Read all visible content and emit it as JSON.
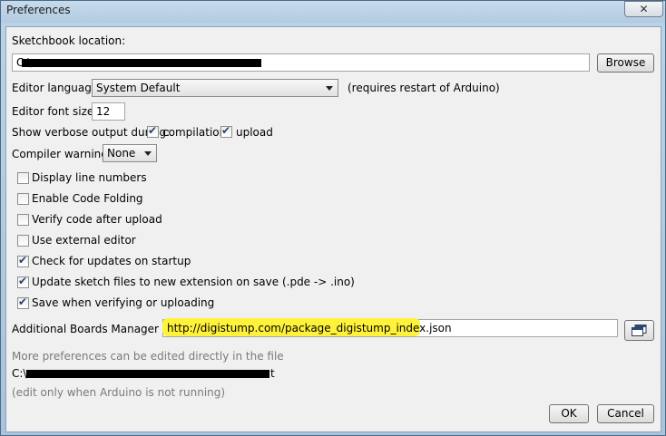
{
  "window": {
    "title": "Preferences",
    "close_glyph": "✕"
  },
  "sketchbook": {
    "label": "Sketchbook location:",
    "value": "C:\\",
    "browse_label": "Browse"
  },
  "language": {
    "label": "Editor language:",
    "value": "System Default",
    "note": "(requires restart of Arduino)"
  },
  "font_size": {
    "label": "Editor font size:",
    "value": "12"
  },
  "verbose": {
    "label": "Show verbose output during:",
    "compilation_label": "compilation",
    "compilation_checked": true,
    "upload_label": "upload",
    "upload_checked": true
  },
  "warnings": {
    "label": "Compiler warnings:",
    "value": "None"
  },
  "options": [
    {
      "label": "Display line numbers",
      "checked": false
    },
    {
      "label": "Enable Code Folding",
      "checked": false
    },
    {
      "label": "Verify code after upload",
      "checked": false
    },
    {
      "label": "Use external editor",
      "checked": false
    },
    {
      "label": "Check for updates on startup",
      "checked": true
    },
    {
      "label": "Update sketch files to new extension on save (.pde -> .ino)",
      "checked": true
    },
    {
      "label": "Save when verifying or uploading",
      "checked": true
    }
  ],
  "boards": {
    "label": "Additional Boards Manager URLs:",
    "value": "http://digistump.com/package_digistump_index.json",
    "highlight_color": "#fff23a"
  },
  "footer": {
    "more_prefs": "More preferences can be edited directly in the file",
    "path_prefix": "C:\\",
    "path_suffix": "t",
    "edit_note": "(edit only when Arduino is not running)"
  },
  "buttons": {
    "ok": "OK",
    "cancel": "Cancel"
  }
}
